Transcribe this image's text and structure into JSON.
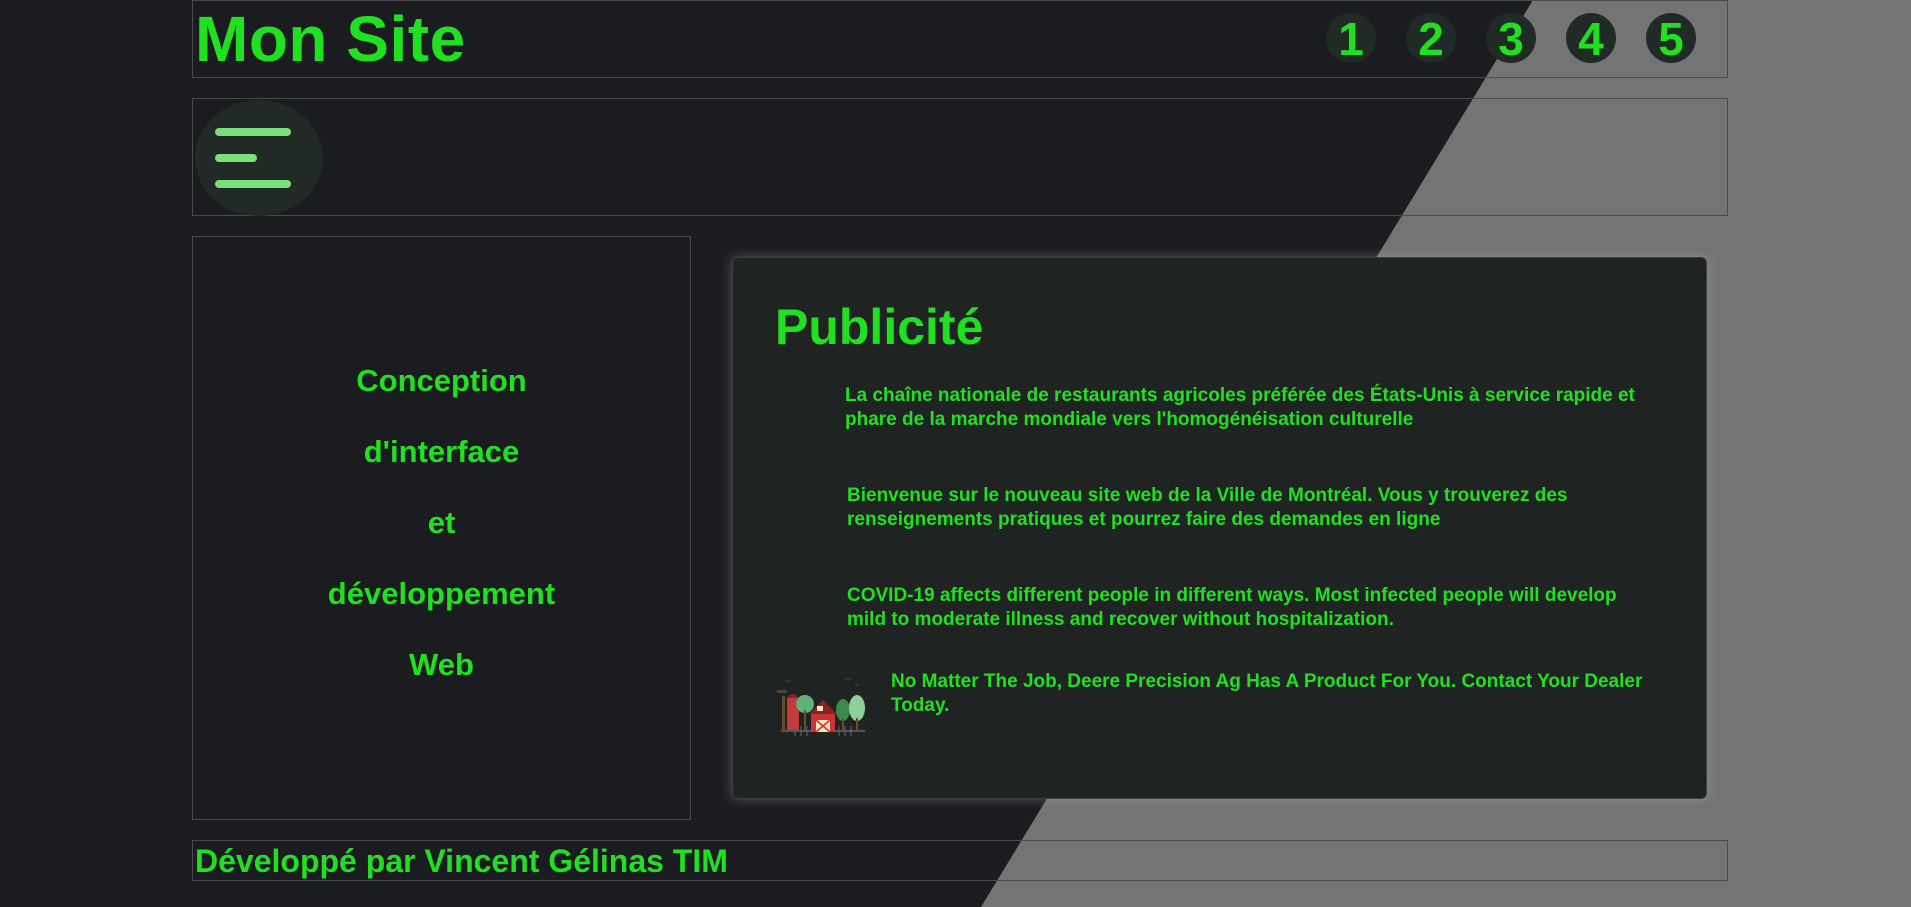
{
  "header": {
    "title": "Mon Site",
    "pages": [
      "1",
      "2",
      "3",
      "4",
      "5"
    ]
  },
  "menu": {
    "icon": "hamburger-menu-icon"
  },
  "aside": {
    "lines": [
      "Conception",
      "d'interface",
      "et",
      "développement",
      "Web"
    ]
  },
  "ad": {
    "title": "Publicité",
    "items": [
      {
        "text": "La chaîne nationale de restaurants agricoles préférée des États-Unis à service rapide et phare de la marche mondiale vers l'homogénéisation culturelle"
      },
      {
        "text": "Bienvenue sur le nouveau site web de la Ville de Montréal. Vous y trouverez des renseignements pratiques et pourrez faire des demandes en ligne"
      },
      {
        "text": "COVID-19 affects different people in different ways. Most infected people will develop mild to moderate illness and recover without hospitalization."
      },
      {
        "text": "No Matter The Job, Deere Precision Ag Has A Product For You. Contact Your Dealer Today.",
        "image": "farm-barn-illustration"
      }
    ]
  },
  "footer": {
    "text": "Développé par Vincent Gélinas TIM"
  },
  "colors": {
    "background": "#1b1c20",
    "accent_green": "#21e021",
    "wedge_gray": "#747474",
    "card_bg": "#1f2422"
  }
}
